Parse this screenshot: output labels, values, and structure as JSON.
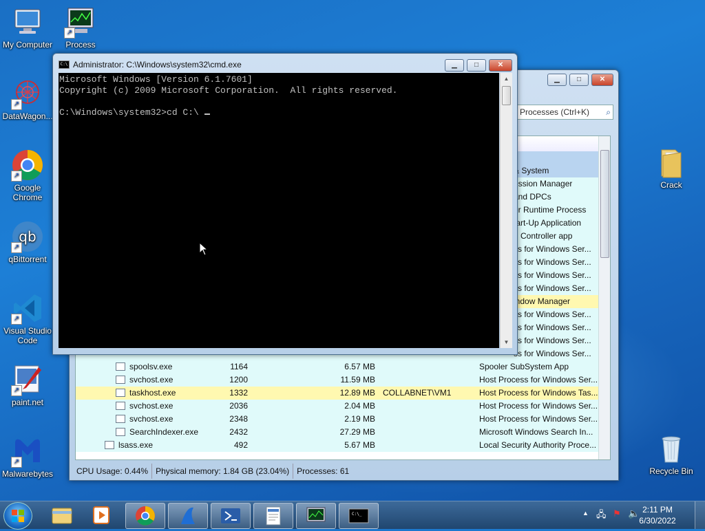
{
  "desktop": {
    "icons": [
      {
        "label": "My Computer"
      },
      {
        "label": "Process"
      },
      {
        "label": "DataWagon..."
      },
      {
        "label": "Google Chrome"
      },
      {
        "label": "qBittorrent"
      },
      {
        "label": "Visual Studio Code"
      },
      {
        "label": "paint.net"
      },
      {
        "label": "Malwarebytes"
      },
      {
        "label": "Crack"
      },
      {
        "label": "Recycle Bin"
      }
    ]
  },
  "task_manager": {
    "search_placeholder": "Processes (Ctrl+K)",
    "column_header": "n",
    "rows_top": [
      {
        "desc": "& System"
      },
      {
        "desc": "ession Manager"
      },
      {
        "desc": "and DPCs"
      },
      {
        "desc": "er Runtime Process"
      },
      {
        "desc": "tart-Up Application"
      },
      {
        "desc": "d Controller app"
      },
      {
        "desc": "ss for Windows Ser..."
      },
      {
        "desc": "ss for Windows Ser..."
      },
      {
        "desc": "ss for Windows Ser..."
      },
      {
        "desc": "ss for Windows Ser..."
      },
      {
        "desc": "indow Manager"
      },
      {
        "desc": "ss for Windows Ser..."
      },
      {
        "desc": "ss for Windows Ser..."
      },
      {
        "desc": "ss for Windows Ser..."
      },
      {
        "desc": "ss for Windows Ser..."
      }
    ],
    "rows": [
      {
        "name": "spoolsv.exe",
        "pid": "1164",
        "mem": "6.57 MB",
        "user": "",
        "desc": "Spooler SubSystem App"
      },
      {
        "name": "svchost.exe",
        "pid": "1200",
        "mem": "11.59 MB",
        "user": "",
        "desc": "Host Process for Windows Ser..."
      },
      {
        "name": "taskhost.exe",
        "pid": "1332",
        "mem": "12.89 MB",
        "user": "COLLABNET\\VM1",
        "desc": "Host Process for Windows Tas..."
      },
      {
        "name": "svchost.exe",
        "pid": "2036",
        "mem": "2.04 MB",
        "user": "",
        "desc": "Host Process for Windows Ser..."
      },
      {
        "name": "svchost.exe",
        "pid": "2348",
        "mem": "2.19 MB",
        "user": "",
        "desc": "Host Process for Windows Ser..."
      },
      {
        "name": "SearchIndexer.exe",
        "pid": "2432",
        "mem": "27.29 MB",
        "user": "",
        "desc": "Microsoft Windows Search In..."
      },
      {
        "name": "lsass.exe",
        "pid": "492",
        "mem": "5.67 MB",
        "user": "",
        "desc": "Local Security Authority Proce..."
      }
    ],
    "status": {
      "cpu": "CPU Usage: 0.44%",
      "memory": "Physical memory: 1.84 GB (23.04%)",
      "processes": "Processes: 61"
    }
  },
  "cmd": {
    "title": "Administrator: C:\\Windows\\system32\\cmd.exe",
    "icon_label": "C:\\",
    "lines": [
      "Microsoft Windows [Version 6.1.7601]",
      "Copyright (c) 2009 Microsoft Corporation.  All rights reserved.",
      "",
      "C:\\Windows\\system32>cd C:\\ "
    ]
  },
  "taskbar": {
    "clock_time": "2:11 PM",
    "clock_date": "6/30/2022"
  },
  "colors": {
    "desktop_blue": "#1d7fd6",
    "row_service": "#e0fafa",
    "row_highlight": "#fff8b0",
    "console_bg": "#000000",
    "console_fg": "#c0c0c0"
  }
}
